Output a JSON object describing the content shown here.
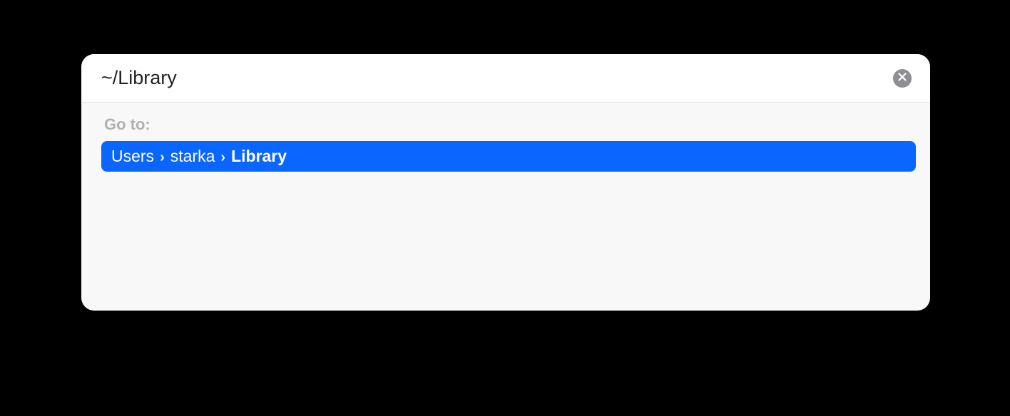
{
  "input": {
    "value": "~/Library",
    "placeholder": ""
  },
  "goto_label": "Go to:",
  "suggestion": {
    "segments": [
      "Users",
      "starka",
      "Library"
    ]
  }
}
